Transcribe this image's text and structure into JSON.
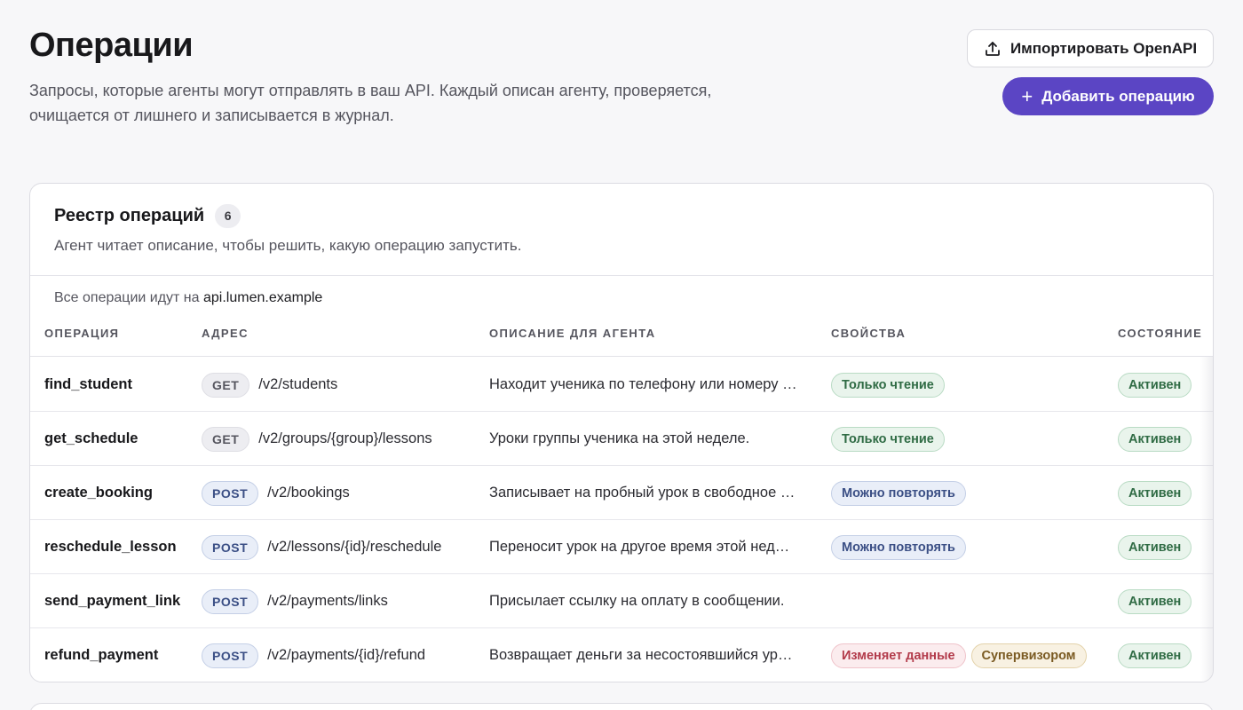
{
  "header": {
    "title": "Операции",
    "description": "Запросы, которые агенты могут отправлять в ваш API. Каждый описан агенту, проверяется, очищается от лишнего и записывается в журнал.",
    "import_label": "Импортировать OpenAPI",
    "add_label": "Добавить операцию"
  },
  "registry": {
    "title": "Реестр операций",
    "count": "6",
    "subtitle": "Агент читает описание, чтобы решить, какую операцию запустить.",
    "host_prefix": "Все операции идут на",
    "host": "api.lumen.example",
    "columns": {
      "name": "ОПЕРАЦИЯ",
      "address": "АДРЕС",
      "description": "ОПИСАНИЕ ДЛЯ АГЕНТА",
      "properties": "СВОЙСТВА",
      "state": "СОСТОЯНИЕ"
    },
    "rows": [
      {
        "name": "find_student",
        "method": "GET",
        "path": "/v2/students",
        "description": "Находит ученика по телефону или номеру …",
        "props": [
          "Только чтение"
        ],
        "state": "Активен"
      },
      {
        "name": "get_schedule",
        "method": "GET",
        "path": "/v2/groups/{group}/lessons",
        "description": "Уроки группы ученика на этой неделе.",
        "props": [
          "Только чтение"
        ],
        "state": "Активен"
      },
      {
        "name": "create_booking",
        "method": "POST",
        "path": "/v2/bookings",
        "description": "Записывает на пробный урок в свободное …",
        "props": [
          "Можно повторять"
        ],
        "state": "Активен"
      },
      {
        "name": "reschedule_lesson",
        "method": "POST",
        "path": "/v2/lessons/{id}/reschedule",
        "description": "Переносит урок на другое время этой нед…",
        "props": [
          "Можно повторять"
        ],
        "state": "Активен"
      },
      {
        "name": "send_payment_link",
        "method": "POST",
        "path": "/v2/payments/links",
        "description": "Присылает ссылку на оплату в сообщении.",
        "props": [],
        "state": "Активен"
      },
      {
        "name": "refund_payment",
        "method": "POST",
        "path": "/v2/payments/{id}/refund",
        "description": "Возвращает деньги за несостоявшийся ур…",
        "props": [
          "Изменяет данные",
          "Супервизором"
        ],
        "state": "Активен"
      }
    ]
  }
}
